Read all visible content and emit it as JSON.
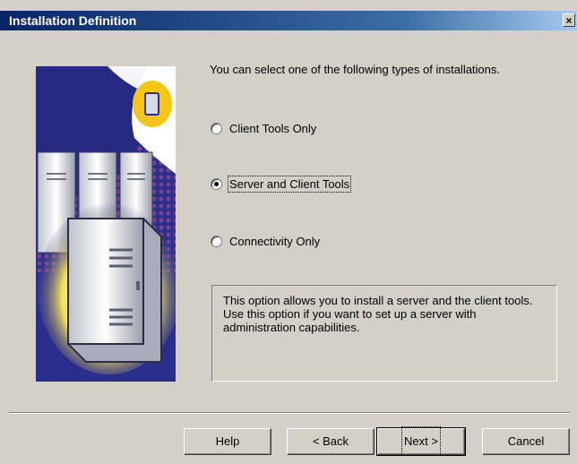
{
  "window": {
    "title": "Installation Definition",
    "close_label": "×"
  },
  "intro_text": "You can select one of the following types of installations.",
  "options": [
    {
      "label": "Client Tools Only",
      "selected": false
    },
    {
      "label": "Server and Client Tools",
      "selected": true
    },
    {
      "label": "Connectivity Only",
      "selected": false
    }
  ],
  "description": "This option allows you to install a server and the client tools. Use this option if you want to set up a server with administration capabilities.",
  "buttons": {
    "help": "Help",
    "back": "< Back",
    "next": "Next >",
    "cancel": "Cancel"
  },
  "colors": {
    "title_active": "#0a246a",
    "dialog_face": "#d4d0c8",
    "art_background": "#2a2f8c",
    "art_accent": "#f5c518"
  }
}
